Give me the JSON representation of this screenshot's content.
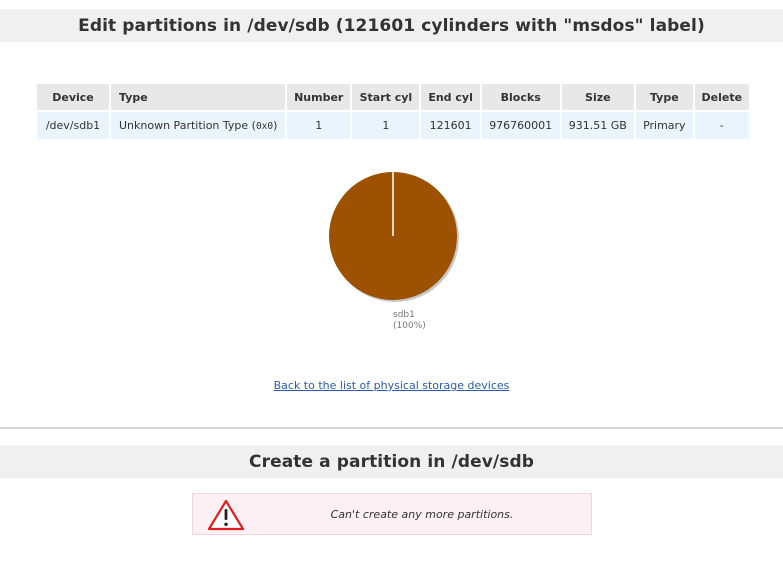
{
  "edit_section": {
    "title": "Edit partitions in /dev/sdb (121601 cylinders with \"msdos\" label)"
  },
  "table": {
    "headers": [
      "Device",
      "Type",
      "Number",
      "Start cyl",
      "End cyl",
      "Blocks",
      "Size",
      "Type",
      "Delete"
    ],
    "rows": [
      {
        "device": "/dev/sdb1",
        "type_label": "Unknown Partition Type (",
        "type_code": "0x0",
        "type_close": ")",
        "number": "1",
        "start_cyl": "1",
        "end_cyl": "121601",
        "blocks": "976760001",
        "size": "931.51 GB",
        "ptype": "Primary",
        "delete": "-"
      }
    ]
  },
  "pie": {
    "slices": [
      {
        "label": "sdb1",
        "percent_text": "(100%)",
        "value": 100,
        "color": "#9c5200"
      }
    ]
  },
  "back_link": "Back to the list of physical storage devices",
  "create_section": {
    "title": "Create a partition in /dev/sdb",
    "warning": "Can't create any more partitions."
  },
  "colors": {
    "header_bg": "#f0f0f0",
    "table_header_bg": "#e8e8e8",
    "table_row_bg": "#eaf4fd",
    "link": "#2a5db0",
    "warning_bg": "#fdf0f4",
    "warning_icon": "#e02020"
  }
}
